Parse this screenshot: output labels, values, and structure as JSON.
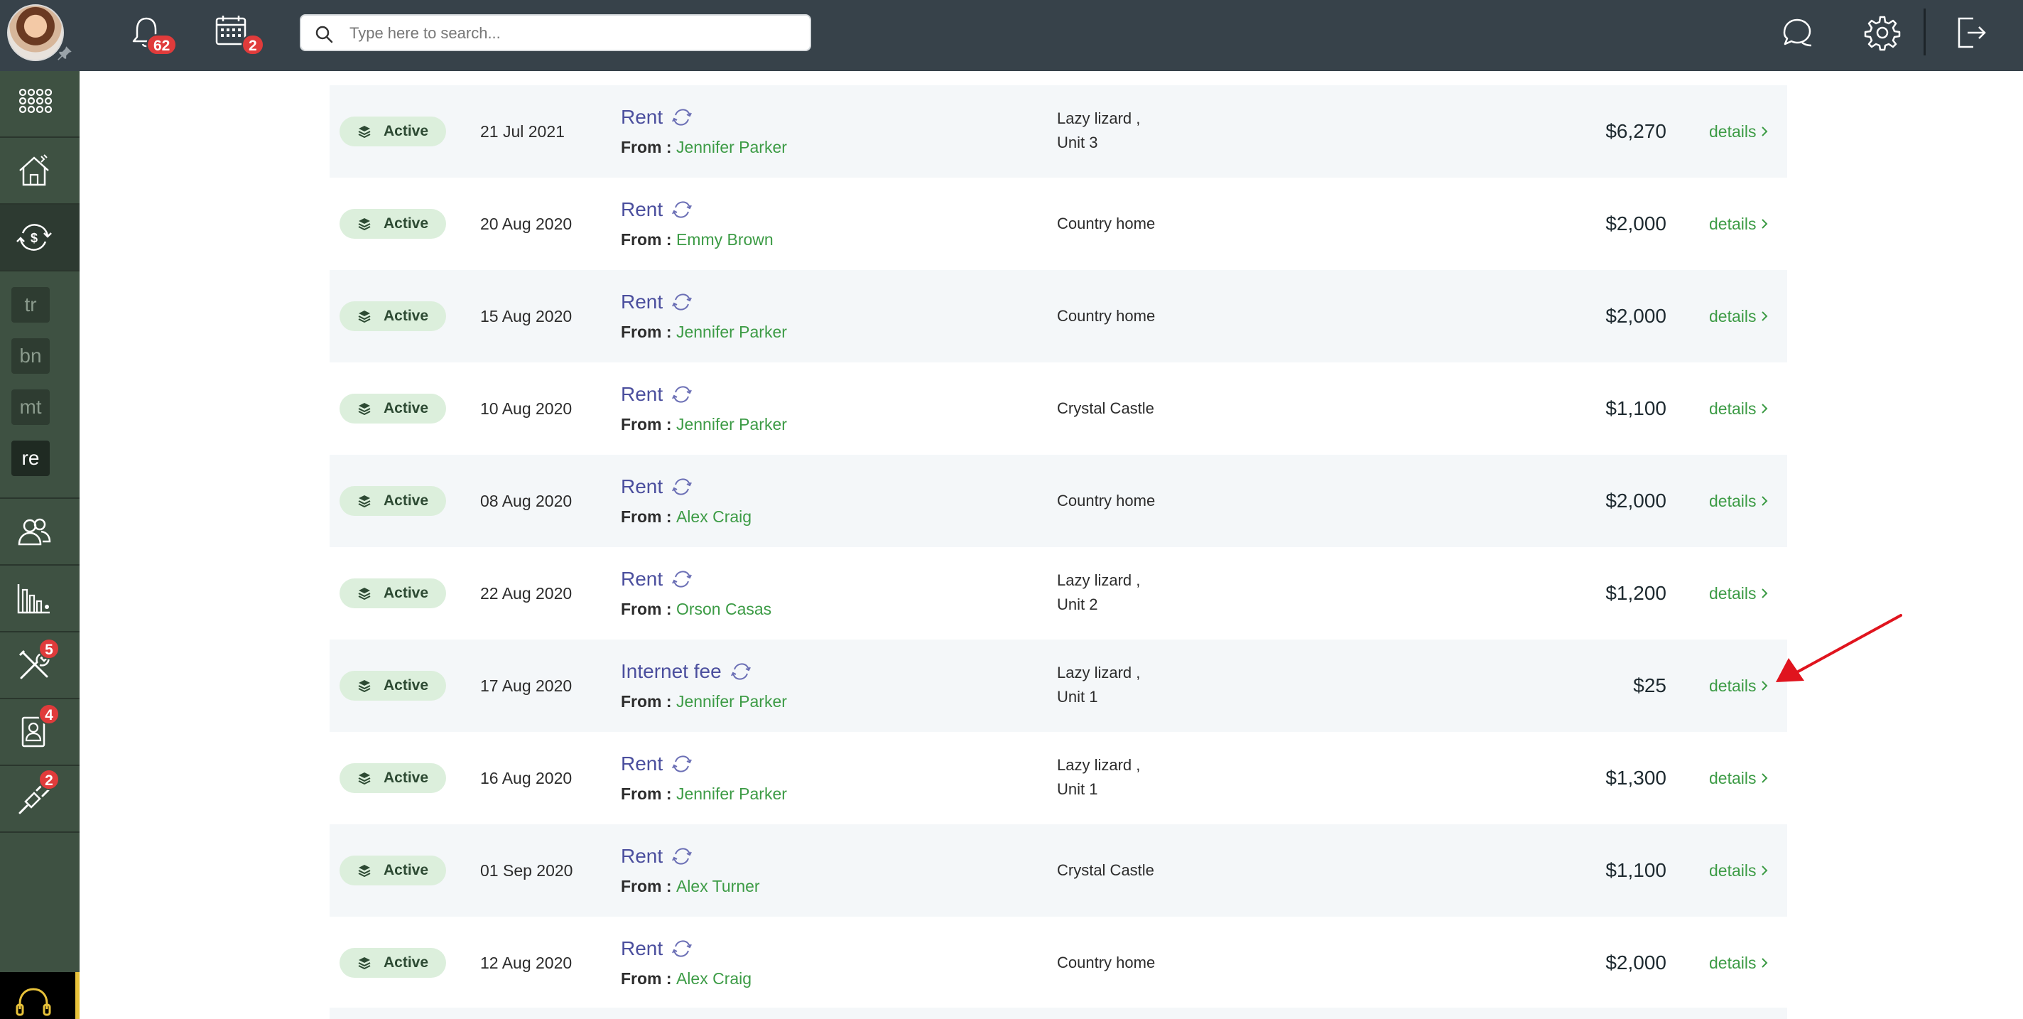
{
  "header": {
    "notifications_count": "62",
    "calendar_count": "2",
    "search_placeholder": "Type here to search..."
  },
  "sidebar": {
    "abbreviations": [
      "tr",
      "bn",
      "mt",
      "re"
    ],
    "badges": {
      "tools": "5",
      "contacts": "4",
      "integrations": "2"
    }
  },
  "table": {
    "status_label": "Active",
    "from_label": "From :",
    "details_label": "details",
    "rows": [
      {
        "date": "21 Jul 2021",
        "type": "Rent",
        "from": "Jennifer Parker",
        "property": "Lazy lizard ,",
        "unit": "Unit 3",
        "amount": "$6,270"
      },
      {
        "date": "20 Aug 2020",
        "type": "Rent",
        "from": "Emmy Brown",
        "property": "Country home",
        "unit": "",
        "amount": "$2,000"
      },
      {
        "date": "15 Aug 2020",
        "type": "Rent",
        "from": "Jennifer Parker",
        "property": "Country home",
        "unit": "",
        "amount": "$2,000"
      },
      {
        "date": "10 Aug 2020",
        "type": "Rent",
        "from": "Jennifer Parker",
        "property": "Crystal Castle",
        "unit": "",
        "amount": "$1,100"
      },
      {
        "date": "08 Aug 2020",
        "type": "Rent",
        "from": "Alex Craig",
        "property": "Country home",
        "unit": "",
        "amount": "$2,000"
      },
      {
        "date": "22 Aug 2020",
        "type": "Rent",
        "from": "Orson Casas",
        "property": "Lazy lizard ,",
        "unit": "Unit 2",
        "amount": "$1,200"
      },
      {
        "date": "17 Aug 2020",
        "type": "Internet fee",
        "from": "Jennifer Parker",
        "property": "Lazy lizard ,",
        "unit": "Unit 1",
        "amount": "$25"
      },
      {
        "date": "16 Aug 2020",
        "type": "Rent",
        "from": "Jennifer Parker",
        "property": "Lazy lizard ,",
        "unit": "Unit 1",
        "amount": "$1,300"
      },
      {
        "date": "01 Sep 2020",
        "type": "Rent",
        "from": "Alex Turner",
        "property": "Crystal Castle",
        "unit": "",
        "amount": "$1,100"
      },
      {
        "date": "12 Aug 2020",
        "type": "Rent",
        "from": "Alex Craig",
        "property": "Country home",
        "unit": "",
        "amount": "$2,000"
      }
    ]
  },
  "colors": {
    "topbar": "#37424a",
    "sidebar": "#3e5142",
    "accent_green": "#3c9b45",
    "title_purple": "#4b4f9e",
    "badge_red": "#e03b3b",
    "annotation_arrow": "#e0141e"
  },
  "icons": {
    "top": [
      "bell-icon",
      "calendar-icon",
      "search-icon",
      "chat-icon",
      "gear-icon",
      "logout-icon"
    ],
    "sidebar": [
      "apps-grid-icon",
      "house-icon",
      "money-cycle-icon",
      "people-icon",
      "bar-chart-icon",
      "tools-icon",
      "contact-card-icon",
      "plug-icon",
      "headset-icon"
    ],
    "row": [
      "layers-icon",
      "recurring-icon",
      "chevron-right-icon"
    ]
  }
}
